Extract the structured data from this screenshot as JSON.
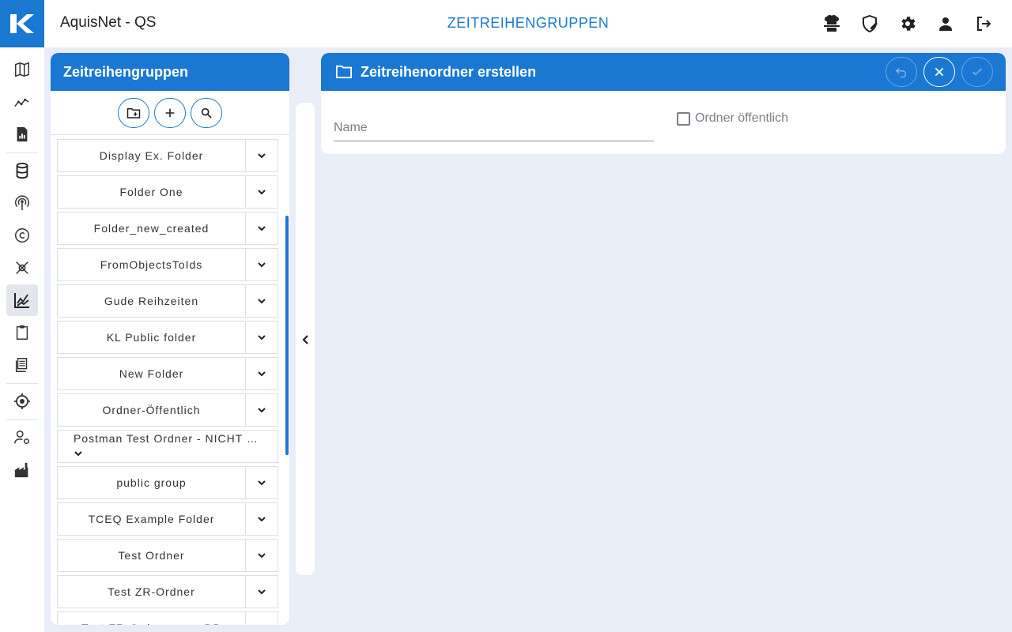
{
  "app": {
    "title": "AquisNet - QS",
    "page_title": "ZEITREIHENGRUPPEN"
  },
  "top_icons": [
    "chef-hat-icon",
    "shield-edit-icon",
    "gear-icon",
    "user-icon",
    "logout-icon"
  ],
  "left_nav": [
    {
      "name": "map-icon",
      "active": false
    },
    {
      "name": "trend-icon",
      "active": false
    },
    {
      "name": "report-icon",
      "active": false
    },
    {
      "name": "database-icon",
      "active": false
    },
    {
      "name": "antenna-icon",
      "active": false
    },
    {
      "name": "copyright-icon",
      "active": false
    },
    {
      "name": "satellite-icon",
      "active": false
    },
    {
      "name": "chart-icon",
      "active": true
    },
    {
      "name": "clipboard-icon",
      "active": false
    },
    {
      "name": "layers-icon",
      "active": false
    },
    {
      "name": "target-icon",
      "active": false
    },
    {
      "name": "user-settings-icon",
      "active": false
    },
    {
      "name": "factory-icon",
      "active": false
    }
  ],
  "groups_panel": {
    "title": "Zeitreihengruppen",
    "actions": [
      "new-folder-icon",
      "add-icon",
      "search-icon"
    ],
    "folders": [
      "Display Ex. Folder",
      "Folder One",
      "Folder_new_created",
      "FromObjectsToIds",
      "Gude Reihzeiten",
      "KL Public folder",
      "New Folder",
      "Ordner-Öffentlich",
      "Postman Test Ordner - NICHT …",
      "public group",
      "TCEQ Example Folder",
      "Test Ordner",
      "Test ZR-Ordner",
      "Test ZR-Ordner neue DB"
    ]
  },
  "create_panel": {
    "title": "Zeitreihenordner erstellen",
    "name_placeholder": "Name",
    "name_value": "",
    "public_label": "Ordner öffentlich",
    "public_checked": false
  },
  "colors": {
    "accent": "#1a78d2",
    "background": "#e8edf7"
  }
}
